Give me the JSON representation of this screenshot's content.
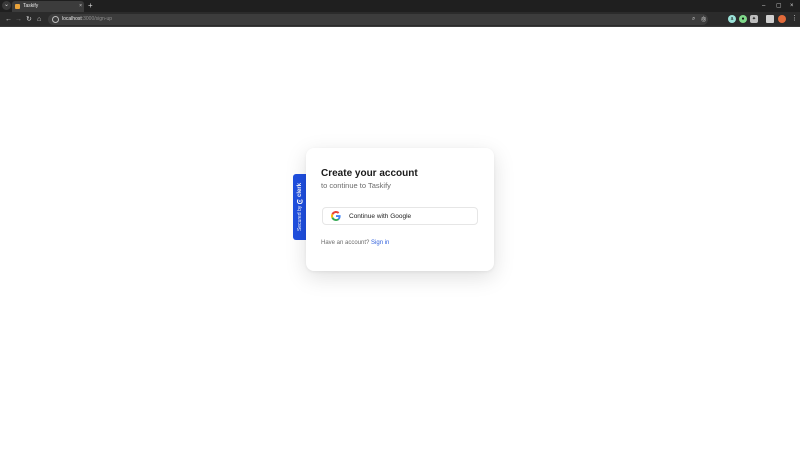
{
  "browser": {
    "tab_title": "Taskify",
    "tab_close": "×",
    "new_tab": "+",
    "url_host": "localhost",
    "url_path": ":3000/sign-up",
    "window_minimize": "–",
    "window_maximize": "▢",
    "window_close": "×"
  },
  "badge": {
    "secured_by": "Secured by",
    "brand": "clerk"
  },
  "card": {
    "title": "Create your account",
    "subtitle": "to continue to Taskify",
    "google_button_label": "Continue with Google",
    "footer_prompt": "Have an account?",
    "footer_link": "Sign in"
  },
  "colors": {
    "badge_bg": "#1f4fe0",
    "link": "#2f5fdc",
    "chrome_dark": "#1f1f1f"
  },
  "icons": {
    "tab_favicon": "taskify-favicon",
    "google": "google-icon",
    "clerk": "clerk-logo-icon"
  }
}
